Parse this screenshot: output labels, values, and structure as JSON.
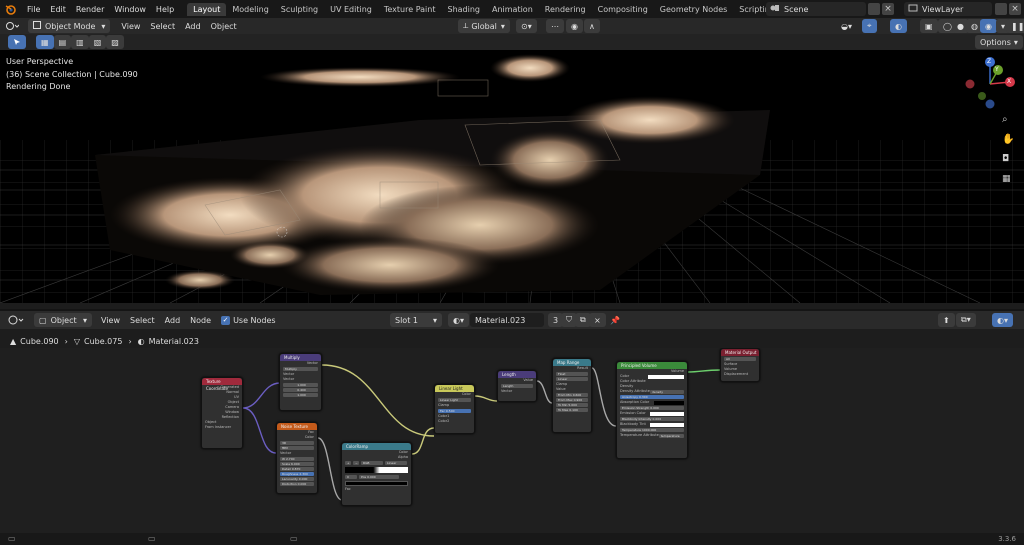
{
  "topbar": {
    "menu": [
      "File",
      "Edit",
      "Render",
      "Window",
      "Help"
    ],
    "workspaces": [
      "Layout",
      "Modeling",
      "Sculpting",
      "UV Editing",
      "Texture Paint",
      "Shading",
      "Animation",
      "Rendering",
      "Compositing",
      "Geometry Nodes",
      "Scripting"
    ],
    "active_workspace": "Layout",
    "add_tab": "+",
    "scene": "Scene",
    "view_layer": "ViewLayer"
  },
  "viewport_header": {
    "mode": "Object Mode",
    "menus": [
      "View",
      "Select",
      "Add",
      "Object"
    ],
    "orientation": "Global",
    "options": "Options"
  },
  "viewport": {
    "perspective": "User Perspective",
    "collection": "(36) Scene Collection | Cube.090",
    "status": "Rendering Done",
    "gizmo_axes": [
      "Z",
      "X",
      "Y"
    ]
  },
  "node_header": {
    "type": "Object",
    "menus": [
      "View",
      "Select",
      "Add",
      "Node"
    ],
    "use_nodes": "Use Nodes",
    "slot": "Slot 1",
    "material": "Material.023",
    "users": "3"
  },
  "breadcrumb": [
    "Cube.090",
    "Cube.075",
    "Material.023"
  ],
  "nodes": {
    "texcoord": {
      "title": "Texture Coordinate",
      "rows": [
        "Generated",
        "Normal",
        "UV",
        "Object",
        "Camera",
        "Window",
        "Reflection",
        "Object",
        "From Instancer"
      ]
    },
    "multiply": {
      "title": "Multiply",
      "rows": [
        "Vector",
        "Multiply",
        "Vector",
        "Vector"
      ],
      "values": [
        "1.000",
        "0.400",
        "1.000"
      ]
    },
    "noise": {
      "title": "Noise Texture",
      "rows": [
        "Fac",
        "Color",
        "3D",
        "fBM",
        "Vector"
      ],
      "values": [
        "2.700",
        "6.000",
        "0.870",
        "2.300",
        "0.000",
        "0.000"
      ],
      "labels": [
        "W",
        "Scale",
        "Detail",
        "Roughness",
        "Lacunarity",
        "Distortion"
      ]
    },
    "colorramp": {
      "title": "ColorRamp",
      "rows": [
        "Color",
        "Alpha",
        "Fac"
      ],
      "controls": [
        "RGB",
        "Linear"
      ],
      "pos": "0",
      "pos_label": "Pos",
      "pos_val": "0.000"
    },
    "linearlight": {
      "title": "Linear Light",
      "rows": [
        "Color",
        "Linear Light",
        "Clamp",
        "Fac",
        "Color1",
        "Color2"
      ],
      "fac": "0.500"
    },
    "length": {
      "title": "Length",
      "rows": [
        "Value",
        "Length",
        "Vector"
      ]
    },
    "maprange": {
      "title": "Map Range",
      "rows": [
        "Result",
        "Float",
        "Linear",
        "Clamp",
        "Value",
        "From Min",
        "From Max",
        "To Min",
        "To Max"
      ],
      "values": [
        "0.600",
        "0.900",
        "5.000",
        "0.100"
      ]
    },
    "volume": {
      "title": "Principled Volume",
      "rows": [
        "Volume",
        "Color",
        "Color Attribute",
        "Density",
        "Density Attribute",
        "Anisotropy",
        "Absorption Color",
        "Emission Strength",
        "Emission Color",
        "Blackbody Intensity",
        "Blackbody Tint",
        "Temperature",
        "Temperature Attribute"
      ],
      "values": [
        "density",
        "0.300",
        "0.000",
        "0.000",
        "1000.000",
        "temperature"
      ]
    },
    "output": {
      "title": "Material Output",
      "rows": [
        "All",
        "Surface",
        "Volume",
        "Displacement"
      ]
    }
  },
  "statusbar": {
    "version": "3.3.6"
  },
  "colors": {
    "accent": "#4772b3",
    "node_header_purple": "#4a3c7a",
    "node_header_red": "#a02a3c",
    "node_header_orange": "#c45a1a",
    "node_header_teal": "#3a7a8a",
    "node_header_yellow": "#c8c85a",
    "node_header_green": "#3a8a3a",
    "node_header_maroon": "#7a2030"
  }
}
